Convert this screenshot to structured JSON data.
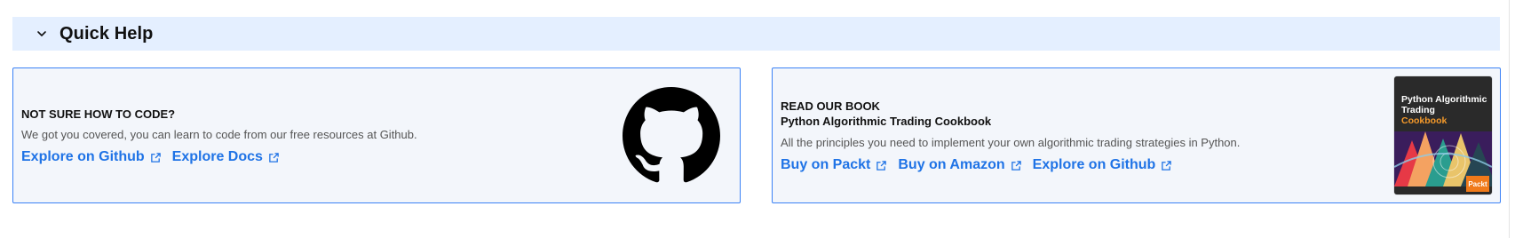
{
  "section": {
    "title": "Quick Help",
    "chevron_icon": "chevron-down-icon"
  },
  "cards": {
    "code": {
      "eyebrow": "NOT SURE HOW TO CODE?",
      "description": "We got you covered, you can learn to code from our free resources at Github.",
      "links": [
        {
          "label": "Explore on Github",
          "icon": "external-link-icon"
        },
        {
          "label": "Explore Docs",
          "icon": "external-link-icon"
        }
      ],
      "logo_icon": "github-icon"
    },
    "book": {
      "eyebrow": "READ OUR BOOK",
      "title": "Python Algorithmic Trading Cookbook",
      "description": "All the principles you need to implement your own algorithmic trading strategies in Python.",
      "links": [
        {
          "label": "Buy on Packt",
          "icon": "external-link-icon"
        },
        {
          "label": "Buy on Amazon",
          "icon": "external-link-icon"
        },
        {
          "label": "Explore on Github",
          "icon": "external-link-icon"
        }
      ],
      "cover": {
        "title": "Python Algorithmic Trading",
        "subtitle": "Cookbook",
        "publisher": "Packt"
      }
    }
  },
  "colors": {
    "header_bg": "#e4efff",
    "card_border": "#3b82f6",
    "card_bg": "#f3f6fb",
    "link": "#1f73e6",
    "cover_accent": "#f59a2a"
  }
}
